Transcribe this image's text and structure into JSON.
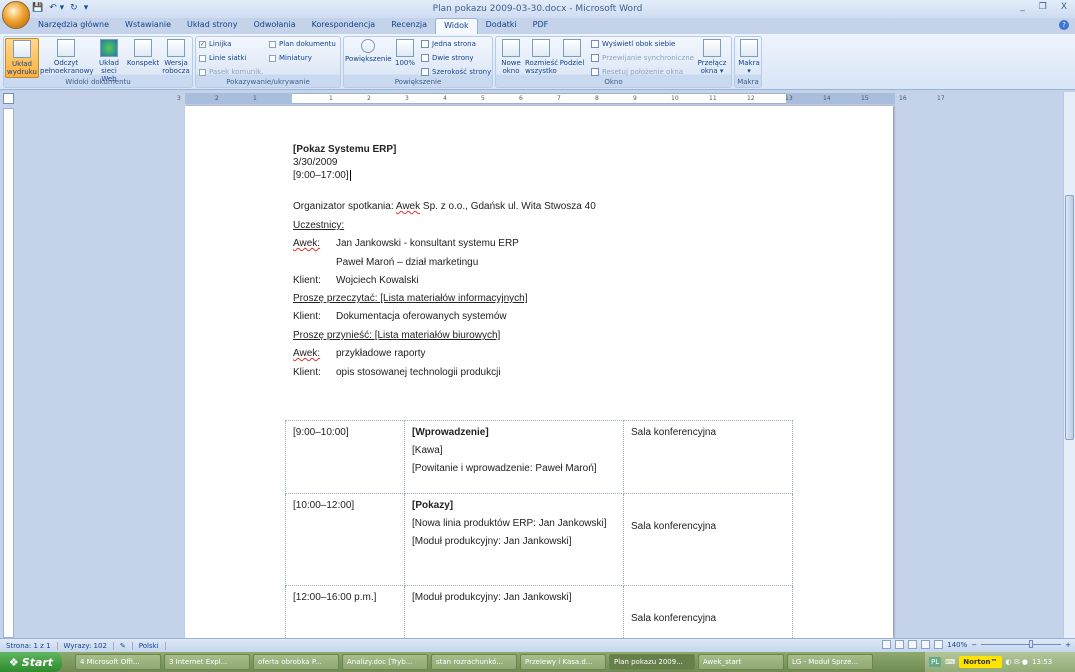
{
  "window": {
    "title": "Plan pokazu 2009-03-30.docx - Microsoft Word",
    "minimize": "_",
    "restore": "❐",
    "close": "X"
  },
  "qat": {
    "save": "💾",
    "undo": "↶ ▾",
    "redo": "↻",
    "customize": "▾"
  },
  "tabs": [
    {
      "label": "Narzędzia główne"
    },
    {
      "label": "Wstawianie"
    },
    {
      "label": "Układ strony"
    },
    {
      "label": "Odwołania"
    },
    {
      "label": "Korespondencja"
    },
    {
      "label": "Recenzja"
    },
    {
      "label": "Widok",
      "active": true
    },
    {
      "label": "Dodatki"
    },
    {
      "label": "PDF"
    }
  ],
  "help": "?",
  "ribbon": {
    "widoki": {
      "label": "Widoki dokumentu",
      "buttons": [
        "Układ wydruku",
        "Odczyt pełnoekranowy",
        "Układ sieci Web",
        "Konspekt",
        "Wersja robocza"
      ]
    },
    "pokazywanie": {
      "label": "Pokazywanie/ukrywanie",
      "linijka": "Linijka",
      "linie": "Linie siatki",
      "pasek": "Pasek komunik.",
      "plan": "Plan dokumentu",
      "miniatury": "Miniatury",
      "linijka_checked": true
    },
    "powiekszenie": {
      "label": "Powiększenie",
      "zoom": "Powiększenie",
      "p100": "100%",
      "jedna": "Jedna strona",
      "dwie": "Dwie strony",
      "szer": "Szerokość strony"
    },
    "okno": {
      "label": "Okno",
      "nowe": "Nowe okno",
      "rozmiesc": "Rozmieść wszystko",
      "podziel": "Podziel",
      "obok": "Wyświetl obok siebie",
      "przewijanie": "Przewijanie synchroniczne",
      "resetuj": "Resetuj położenie okna",
      "przelacz": "Przełącz okna ▾"
    },
    "makra": {
      "label": "Makra",
      "button": "Makra ▾"
    }
  },
  "ruler_numbers": [
    "3",
    "2",
    "1",
    "1",
    "2",
    "3",
    "4",
    "5",
    "6",
    "7",
    "8",
    "9",
    "10",
    "11",
    "12",
    "13",
    "14",
    "15",
    "16",
    "17"
  ],
  "document": {
    "title": "[Pokaz Systemu ERP]",
    "date": "3/30/2009",
    "time": "[9:00–17:00]",
    "organizer_prefix": "Organizator spotkania: ",
    "organizer_name": "Awek",
    "organizer_rest": " Sp. z o.o., Gdańsk ul. Wita Stwosza 40",
    "participants_heading": "Uczestnicy:",
    "lines": [
      {
        "label": "Awek:",
        "text": "Jan Jankowski -  konsultant systemu ERP",
        "squiggle": true
      },
      {
        "label": "",
        "text": "Paweł Maroń – dział marketingu"
      },
      {
        "label": "Klient:",
        "text": "Wojciech Kowalski"
      }
    ],
    "read_heading": "Proszę przeczytać: [Lista materiałów informacyjnych]",
    "read_lines": [
      {
        "label": "Klient:",
        "text": "Dokumentacja oferowanych systemów"
      }
    ],
    "bring_heading": "Proszę przynieść: [Lista materiałów biurowych]",
    "bring_lines": [
      {
        "label": "Awek:",
        "text": "przykładowe raporty",
        "squiggle": true
      },
      {
        "label": "Klient:",
        "text": "opis stosowanej technologii produkcji"
      }
    ],
    "agenda": [
      {
        "time": "[9:00–10:00]",
        "title": "[Wprowadzenie]",
        "items": [
          "[Kawa]",
          "[Powitanie i wprowadzenie: Paweł Maroń]"
        ],
        "room": "Sala konferencyjna"
      },
      {
        "time": "[10:00–12:00]",
        "title": "[Pokazy]",
        "items": [
          "[Nowa linia produktów ERP: Jan Jankowski]",
          "[Moduł produkcyjny: Jan Jankowski]"
        ],
        "room": "Sala konferencyjna"
      },
      {
        "time": "[12:00–16:00 p.m.]",
        "title": "",
        "items": [
          "[Moduł produkcyjny: Jan Jankowski]"
        ],
        "room": "Sala konferencyjna"
      }
    ]
  },
  "status": {
    "page": "Strona: 1 z 1",
    "words": "Wyrazy: 102",
    "language": "Polski",
    "zoom": "140%",
    "minus": "−",
    "plus": "+"
  },
  "taskbar": {
    "start": "Start",
    "tasks": [
      "4 Microsoft Offi...",
      "3 Internet Expl...",
      "oferta obrobka P...",
      "Analizy.doc [Tryb...",
      "stan rozrachunkó...",
      "Przelewy i Kasa.d...",
      "Plan pokazu 2009...",
      "Awek_start",
      "LG - Moduł Sprze..."
    ],
    "active_task": 6,
    "lang": "PL",
    "norton": "Norton™",
    "clock": "13:53"
  }
}
